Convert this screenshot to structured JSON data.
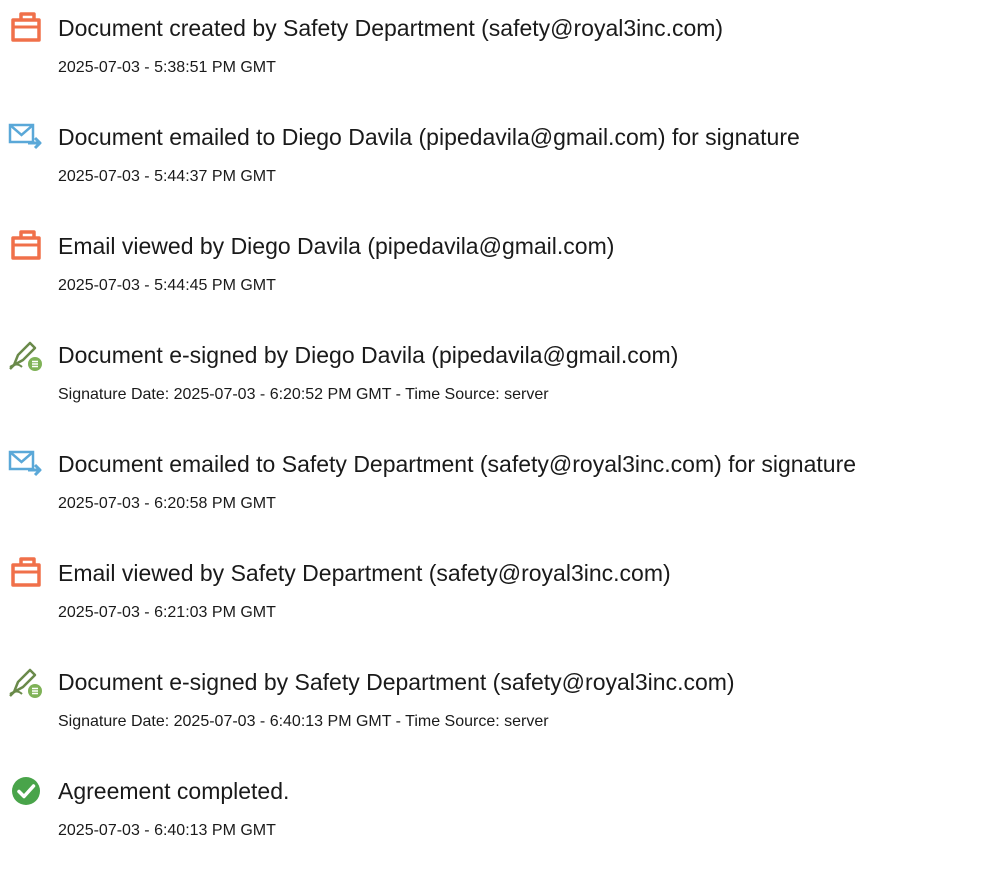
{
  "colors": {
    "document_icon": "#f0704a",
    "email_icon": "#5aa8d8",
    "sign_icon": "#7fb257",
    "complete_icon": "#49a44a"
  },
  "events": [
    {
      "icon": "document-created-icon",
      "title": "Document created by Safety Department (safety@royal3inc.com)",
      "detail": "2025-07-03 - 5:38:51 PM GMT"
    },
    {
      "icon": "email-sent-icon",
      "title": "Document emailed to Diego Davila (pipedavila@gmail.com) for signature",
      "detail": "2025-07-03 - 5:44:37 PM GMT"
    },
    {
      "icon": "document-viewed-icon",
      "title": "Email viewed by Diego Davila (pipedavila@gmail.com)",
      "detail": "2025-07-03 - 5:44:45 PM GMT"
    },
    {
      "icon": "e-sign-icon",
      "title": "Document e-signed by Diego Davila (pipedavila@gmail.com)",
      "detail": "Signature Date: 2025-07-03 - 6:20:52 PM GMT - Time Source: server"
    },
    {
      "icon": "email-sent-icon",
      "title": "Document emailed to Safety Department (safety@royal3inc.com) for signature",
      "detail": "2025-07-03 - 6:20:58 PM GMT"
    },
    {
      "icon": "document-viewed-icon",
      "title": "Email viewed by Safety Department (safety@royal3inc.com)",
      "detail": "2025-07-03 - 6:21:03 PM GMT"
    },
    {
      "icon": "e-sign-icon",
      "title": "Document e-signed by Safety Department (safety@royal3inc.com)",
      "detail": "Signature Date: 2025-07-03 - 6:40:13 PM GMT - Time Source: server"
    },
    {
      "icon": "agreement-completed-icon",
      "title": "Agreement completed.",
      "detail": "2025-07-03 - 6:40:13 PM GMT"
    }
  ]
}
